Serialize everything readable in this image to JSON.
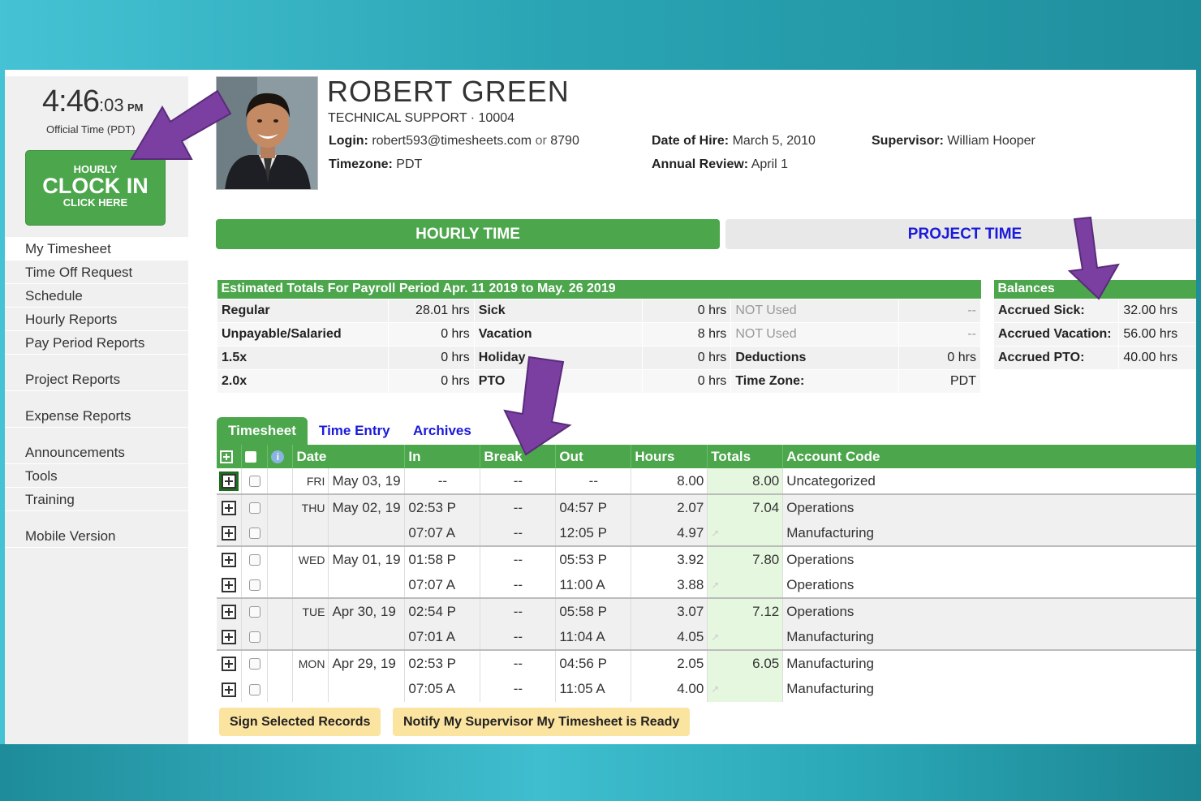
{
  "clock": {
    "hm": "4:46",
    "sec": ":03",
    "ampm": "PM",
    "subtitle": "Official Time (PDT)"
  },
  "clock_in_button": {
    "line1": "HOURLY",
    "line2": "CLOCK IN",
    "line3": "CLICK HERE"
  },
  "sidebar": {
    "items": [
      {
        "label": "My Timesheet"
      },
      {
        "label": "Time Off Request"
      },
      {
        "label": "Schedule"
      },
      {
        "label": "Hourly Reports"
      },
      {
        "label": "Pay Period Reports"
      },
      {
        "label": "Project Reports"
      },
      {
        "label": "Expense Reports"
      },
      {
        "label": "Announcements"
      },
      {
        "label": "Tools"
      },
      {
        "label": "Training"
      },
      {
        "label": "Mobile Version"
      }
    ]
  },
  "employee": {
    "name": "ROBERT GREEN",
    "department": "TECHNICAL SUPPORT · 10004",
    "login_label": "Login:",
    "login_value": "robert593@timesheets.com",
    "or_text": "or",
    "login_pin": "8790",
    "timezone_label": "Timezone:",
    "timezone_value": "PDT",
    "hire_label": "Date of Hire:",
    "hire_value": "March 5, 2010",
    "review_label": "Annual Review:",
    "review_value": "April 1",
    "supervisor_label": "Supervisor:",
    "supervisor_value": "William Hooper"
  },
  "time_tabs": {
    "hourly": "HOURLY TIME",
    "project": "PROJECT TIME"
  },
  "estimated": {
    "title": "Estimated Totals For Payroll Period Apr. 11 2019 to May. 26 2019",
    "rows": [
      [
        "Regular",
        "28.01 hrs",
        "Sick",
        "0 hrs",
        "NOT Used",
        "--"
      ],
      [
        "Unpayable/Salaried",
        "0 hrs",
        "Vacation",
        "8 hrs",
        "NOT Used",
        "--"
      ],
      [
        "1.5x",
        "0 hrs",
        "Holiday",
        "0 hrs",
        "Deductions",
        "0 hrs"
      ],
      [
        "2.0x",
        "0 hrs",
        "PTO",
        "0 hrs",
        "Time Zone:",
        "PDT"
      ]
    ]
  },
  "balances": {
    "title": "Balances",
    "rows": [
      [
        "Accrued Sick:",
        "32.00 hrs"
      ],
      [
        "Accrued Vacation:",
        "56.00 hrs"
      ],
      [
        "Accrued PTO:",
        "40.00 hrs"
      ]
    ]
  },
  "subtabs": {
    "timesheet": "Timesheet",
    "time_entry": "Time Entry",
    "archives": "Archives"
  },
  "timesheet": {
    "headers": {
      "date": "Date",
      "in": "In",
      "break": "Break",
      "out": "Out",
      "hours": "Hours",
      "totals": "Totals",
      "account": "Account Code"
    },
    "rows": [
      {
        "day": "FRI",
        "date": "May 03, 19",
        "in": "--",
        "brk": "--",
        "out": "--",
        "hours": "8.00",
        "total": "8.00",
        "account": "Uncategorized"
      },
      {
        "day": "THU",
        "date": "May 02, 19",
        "in": "02:53 P",
        "brk": "--",
        "out": "04:57 P",
        "hours": "2.07",
        "total": "7.04",
        "account": "Operations"
      },
      {
        "day": "",
        "date": "",
        "in": "07:07 A",
        "brk": "--",
        "out": "12:05 P",
        "hours": "4.97",
        "total": "",
        "account": "Manufacturing"
      },
      {
        "day": "WED",
        "date": "May 01, 19",
        "in": "01:58 P",
        "brk": "--",
        "out": "05:53 P",
        "hours": "3.92",
        "total": "7.80",
        "account": "Operations"
      },
      {
        "day": "",
        "date": "",
        "in": "07:07 A",
        "brk": "--",
        "out": "11:00 A",
        "hours": "3.88",
        "total": "",
        "account": "Operations"
      },
      {
        "day": "TUE",
        "date": "Apr 30, 19",
        "in": "02:54 P",
        "brk": "--",
        "out": "05:58 P",
        "hours": "3.07",
        "total": "7.12",
        "account": "Operations"
      },
      {
        "day": "",
        "date": "",
        "in": "07:01 A",
        "brk": "--",
        "out": "11:04 A",
        "hours": "4.05",
        "total": "",
        "account": "Manufacturing"
      },
      {
        "day": "MON",
        "date": "Apr 29, 19",
        "in": "02:53 P",
        "brk": "--",
        "out": "04:56 P",
        "hours": "2.05",
        "total": "6.05",
        "account": "Manufacturing"
      },
      {
        "day": "",
        "date": "",
        "in": "07:05 A",
        "brk": "--",
        "out": "11:05 A",
        "hours": "4.00",
        "total": "",
        "account": "Manufacturing"
      }
    ]
  },
  "buttons": {
    "sign": "Sign Selected Records",
    "notify": "Notify My Supervisor My Timesheet is Ready"
  },
  "colors": {
    "green": "#4ca64c",
    "link_blue": "#1a1adb",
    "annotation_purple": "#7a3fa0",
    "button_yellow": "#fbe3a0"
  }
}
